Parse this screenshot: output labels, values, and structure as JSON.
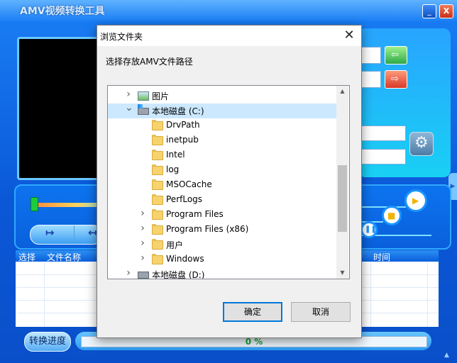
{
  "app": {
    "title": "AMV视频转换工具",
    "minimize_glyph": "_",
    "close_glyph": "X",
    "list_headers": {
      "select": "选择",
      "filename": "文件名称",
      "time": "时间"
    },
    "progress_button_label": "转换进度",
    "progress_text": "0 %",
    "progress_fraction": 0
  },
  "dialog": {
    "title": "浏览文件夹",
    "close_glyph": "✕",
    "prompt": "选择存放AMV文件路径",
    "tree": [
      {
        "label": "图片",
        "icon": "pictures-icon",
        "expander": "collapsed",
        "depth": 1,
        "selected": false
      },
      {
        "label": "本地磁盘 (C:)",
        "icon": "drive-icon",
        "expander": "expanded",
        "depth": 1,
        "selected": true
      },
      {
        "label": "DrvPath",
        "icon": "folder-icon",
        "expander": "none",
        "depth": 2,
        "selected": false
      },
      {
        "label": "inetpub",
        "icon": "folder-icon",
        "expander": "none",
        "depth": 2,
        "selected": false
      },
      {
        "label": "Intel",
        "icon": "folder-icon",
        "expander": "none",
        "depth": 2,
        "selected": false
      },
      {
        "label": "log",
        "icon": "folder-icon",
        "expander": "none",
        "depth": 2,
        "selected": false
      },
      {
        "label": "MSOCache",
        "icon": "folder-icon",
        "expander": "none",
        "depth": 2,
        "selected": false
      },
      {
        "label": "PerfLogs",
        "icon": "folder-icon",
        "expander": "none",
        "depth": 2,
        "selected": false
      },
      {
        "label": "Program Files",
        "icon": "folder-icon",
        "expander": "collapsed",
        "depth": 2,
        "selected": false
      },
      {
        "label": "Program Files (x86)",
        "icon": "folder-icon",
        "expander": "collapsed",
        "depth": 2,
        "selected": false
      },
      {
        "label": "用户",
        "icon": "folder-icon",
        "expander": "collapsed",
        "depth": 2,
        "selected": false
      },
      {
        "label": "Windows",
        "icon": "folder-icon",
        "expander": "collapsed",
        "depth": 2,
        "selected": false
      },
      {
        "label": "本地磁盘 (D:)",
        "icon": "drive-icon",
        "expander": "collapsed",
        "depth": 1,
        "selected": false
      }
    ],
    "ok_label": "确定",
    "cancel_label": "取消"
  },
  "colors": {
    "selection": "#cce8ff",
    "default_button_border": "#0078d7",
    "app_blue": "#0a60dc",
    "progress_text": "#1ca53a"
  }
}
